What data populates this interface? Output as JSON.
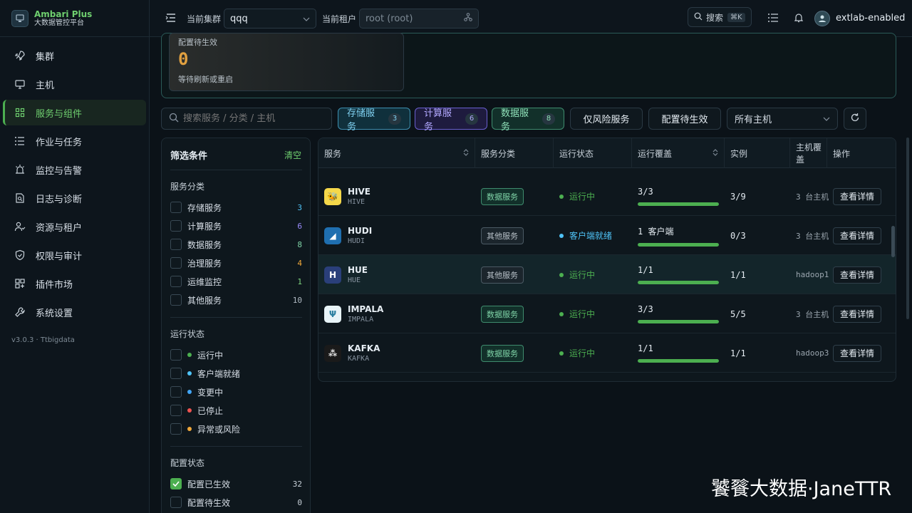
{
  "brand": {
    "name": "Ambari Plus",
    "subtitle": "大数据管控平台"
  },
  "nav": [
    {
      "label": "集群",
      "icon": "rocket-icon"
    },
    {
      "label": "主机",
      "icon": "monitor-icon"
    },
    {
      "label": "服务与组件",
      "icon": "grid-icon",
      "active": true
    },
    {
      "label": "作业与任务",
      "icon": "list-icon"
    },
    {
      "label": "监控与告警",
      "icon": "alarm-icon"
    },
    {
      "label": "日志与诊断",
      "icon": "file-search-icon"
    },
    {
      "label": "资源与租户",
      "icon": "users-icon"
    },
    {
      "label": "权限与审计",
      "icon": "shield-icon"
    },
    {
      "label": "插件市场",
      "icon": "plugin-icon"
    },
    {
      "label": "系统设置",
      "icon": "wrench-icon"
    }
  ],
  "version": "v3.0.3 · Ttbigdata",
  "topbar": {
    "cluster_label": "当前集群",
    "cluster_value": "qqq",
    "tenant_label": "当前租户",
    "tenant_value": "root (root)",
    "search_label": "搜索",
    "search_kbd": "⌘K",
    "user": "extlab-enabled"
  },
  "summary": {
    "title": "配置待生效",
    "value": "0",
    "note": "等待刷新或重启"
  },
  "toolbar": {
    "search_placeholder": "搜索服务 / 分类 / 主机",
    "chips": [
      {
        "label": "存储服务",
        "count": "3"
      },
      {
        "label": "计算服务",
        "count": "6"
      },
      {
        "label": "数据服务",
        "count": "8"
      }
    ],
    "risk_only": "仅风险服务",
    "pending": "配置待生效",
    "host_select": "所有主机"
  },
  "filters": {
    "title": "筛选条件",
    "clear": "清空",
    "category_title": "服务分类",
    "categories": [
      {
        "label": "存储服务",
        "count": "3",
        "color": "#4fc3f7"
      },
      {
        "label": "计算服务",
        "count": "6",
        "color": "#9b8cff"
      },
      {
        "label": "数据服务",
        "count": "8",
        "color": "#7fd3a7"
      },
      {
        "label": "治理服务",
        "count": "4",
        "color": "#f0a83a"
      },
      {
        "label": "运维监控",
        "count": "1",
        "color": "#7fd37f"
      },
      {
        "label": "其他服务",
        "count": "10",
        "color": "#b0bac3"
      }
    ],
    "status_title": "运行状态",
    "statuses": [
      {
        "label": "运行中",
        "color": "#4caf50"
      },
      {
        "label": "客户端就绪",
        "color": "#4fc3f7"
      },
      {
        "label": "变更中",
        "color": "#42a5f5"
      },
      {
        "label": "已停止",
        "color": "#ef5350"
      },
      {
        "label": "异常或风险",
        "color": "#f0a83a"
      }
    ],
    "config_title": "配置状态",
    "configs": [
      {
        "label": "配置已生效",
        "count": "32",
        "checked": true
      },
      {
        "label": "配置待生效",
        "count": "0",
        "checked": false
      }
    ]
  },
  "table": {
    "columns": [
      "服务",
      "服务分类",
      "运行状态",
      "运行覆盖",
      "实例",
      "主机覆盖",
      "操作"
    ],
    "rows": [
      {
        "name": "HIVE",
        "code": "HIVE",
        "category": "数据服务",
        "cat_type": "data",
        "status": "运行中",
        "status_color": "#4caf50",
        "coverage": "3/3",
        "coverage_pct": 1,
        "instances": "3/9",
        "hosts": "3 台主机",
        "action": "查看详情",
        "icon": "hive-icon",
        "icon_bg": "#f5d84a",
        "icon_fg": "#2a2a10",
        "icon_glyph": "🐝"
      },
      {
        "name": "HUDI",
        "code": "HUDI",
        "category": "其他服务",
        "cat_type": "other",
        "status": "客户端就绪",
        "status_color": "#4fc3f7",
        "coverage": "1 客户端",
        "coverage_pct": 1,
        "instances": "0/3",
        "hosts": "3 台主机",
        "action": "查看详情",
        "icon": "hudi-icon",
        "icon_bg": "#1f6fb0",
        "icon_fg": "#ffffff",
        "icon_glyph": "◢"
      },
      {
        "name": "HUE",
        "code": "HUE",
        "category": "其他服务",
        "cat_type": "other",
        "status": "运行中",
        "status_color": "#4caf50",
        "coverage": "1/1",
        "coverage_pct": 1,
        "instances": "1/1",
        "hosts": "hadoop1",
        "action": "查看详情",
        "icon": "hue-icon",
        "icon_bg": "#2a3f7a",
        "icon_fg": "#ffffff",
        "icon_glyph": "H"
      },
      {
        "name": "IMPALA",
        "code": "IMPALA",
        "category": "数据服务",
        "cat_type": "data",
        "status": "运行中",
        "status_color": "#4caf50",
        "coverage": "3/3",
        "coverage_pct": 1,
        "instances": "5/5",
        "hosts": "3 台主机",
        "action": "查看详情",
        "icon": "impala-icon",
        "icon_bg": "#e8f4f8",
        "icon_fg": "#2a7fa0",
        "icon_glyph": "Ψ"
      },
      {
        "name": "KAFKA",
        "code": "KAFKA",
        "category": "数据服务",
        "cat_type": "data",
        "status": "运行中",
        "status_color": "#4caf50",
        "coverage": "1/1",
        "coverage_pct": 1,
        "instances": "1/1",
        "hosts": "hadoop3",
        "action": "查看详情",
        "icon": "kafka-icon",
        "icon_bg": "#1a1a1a",
        "icon_fg": "#e6e6e6",
        "icon_glyph": "⁂"
      }
    ]
  },
  "watermark": "饕餮大数据·JaneTTR"
}
